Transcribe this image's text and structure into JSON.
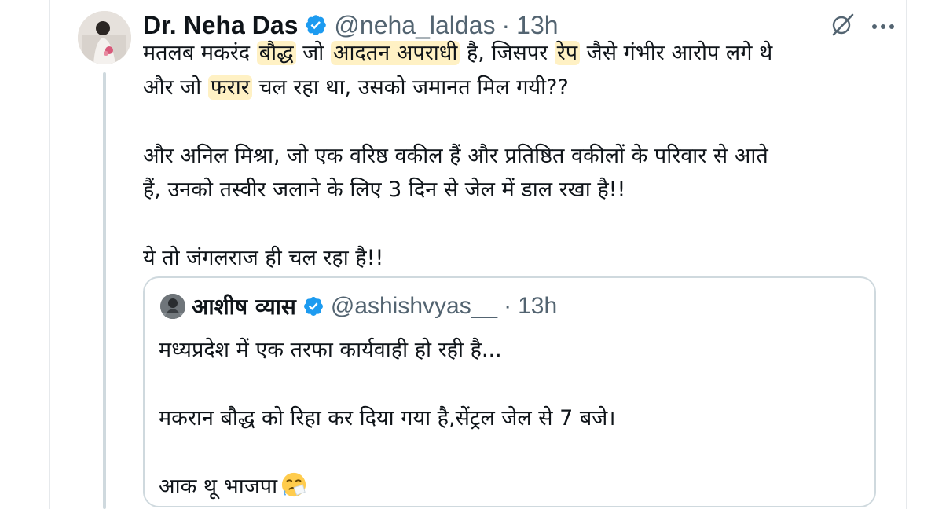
{
  "tweet": {
    "author_name": "Dr. Neha Das",
    "handle": "@neha_laldas",
    "separator": "·",
    "time": "13h",
    "lines": {
      "l1_a": "मतलब मकरंद ",
      "l1_hl1": "बौद्ध",
      "l1_b": " जो ",
      "l1_hl2": "आदतन अपराधी",
      "l1_c": " है, जिसपर ",
      "l1_hl3": "रेप",
      "l1_d": " जैसे गंभीर आरोप लगे थे",
      "l2_a": "और जो ",
      "l2_hl1": "फरार",
      "l2_b": " चल रहा था, उसको जमानत मिल गयी??",
      "l3": "और अनिल मिश्रा, जो एक वरिष्ठ वकील हैं और प्रतिष्ठित वकीलों के परिवार से आते",
      "l4": "हैं, उनको तस्वीर जलाने के लिए 3 दिन से जेल में डाल रखा है!!",
      "l5": "ये तो जंगलराज ही चल रहा है!!"
    },
    "highlight_color": "#fff1c4"
  },
  "quote": {
    "author_name": "आशीष व्यास",
    "handle": "@ashishvyas__",
    "separator": "·",
    "time": "13h",
    "line1": "मध्यप्रदेश में एक तरफा कार्यवाही हो रही है...",
    "line2": "मकरान बौद्ध को रिहा कर दिया गया है,सेंट्रल जेल से 7 बजे।",
    "line3": "आक थू भाजपा"
  },
  "icons": {
    "verified": "verified-badge-icon",
    "grok": "grok-icon",
    "more": "more-options-icon",
    "emoji": "sneezing-face-emoji"
  },
  "colors": {
    "verified_blue": "#1d9bf0",
    "text_primary": "#0f1419",
    "text_secondary": "#536471",
    "border": "#cfd9de"
  }
}
